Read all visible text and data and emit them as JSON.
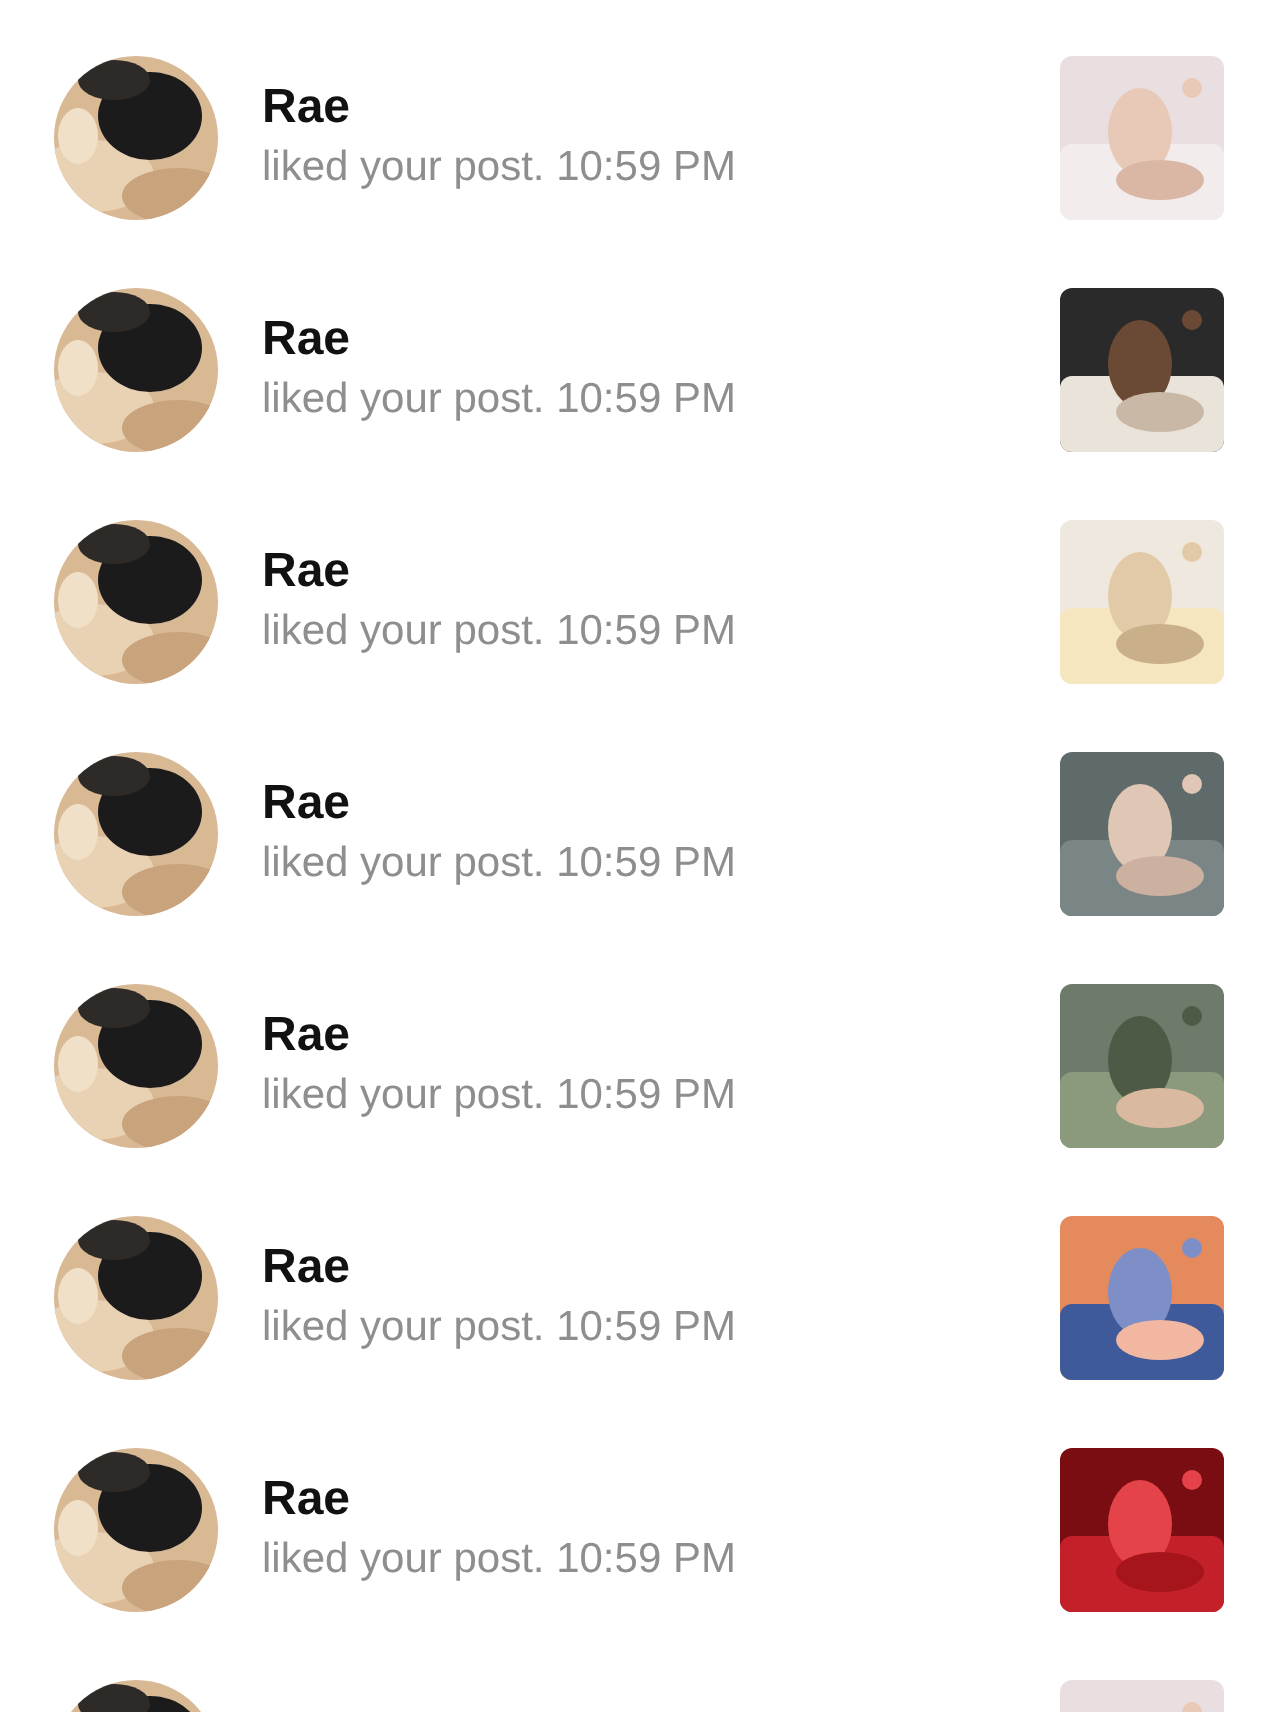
{
  "notifications": [
    {
      "kind": "full",
      "name": "Rae",
      "detail": "liked your post. 10:59 PM"
    },
    {
      "kind": "full",
      "name": "Rae",
      "detail": "liked your post. 10:59 PM"
    },
    {
      "kind": "full",
      "name": "Rae",
      "detail": "liked your post. 10:59 PM"
    },
    {
      "kind": "full",
      "name": "Rae",
      "detail": "liked your post. 10:59 PM"
    },
    {
      "kind": "full",
      "name": "Rae",
      "detail": "liked your post. 10:59 PM"
    },
    {
      "kind": "full",
      "name": "Rae",
      "detail": "liked your post. 10:59 PM"
    },
    {
      "kind": "full",
      "name": "Rae",
      "detail": "liked your post. 10:59 PM"
    },
    {
      "kind": "cut"
    }
  ]
}
